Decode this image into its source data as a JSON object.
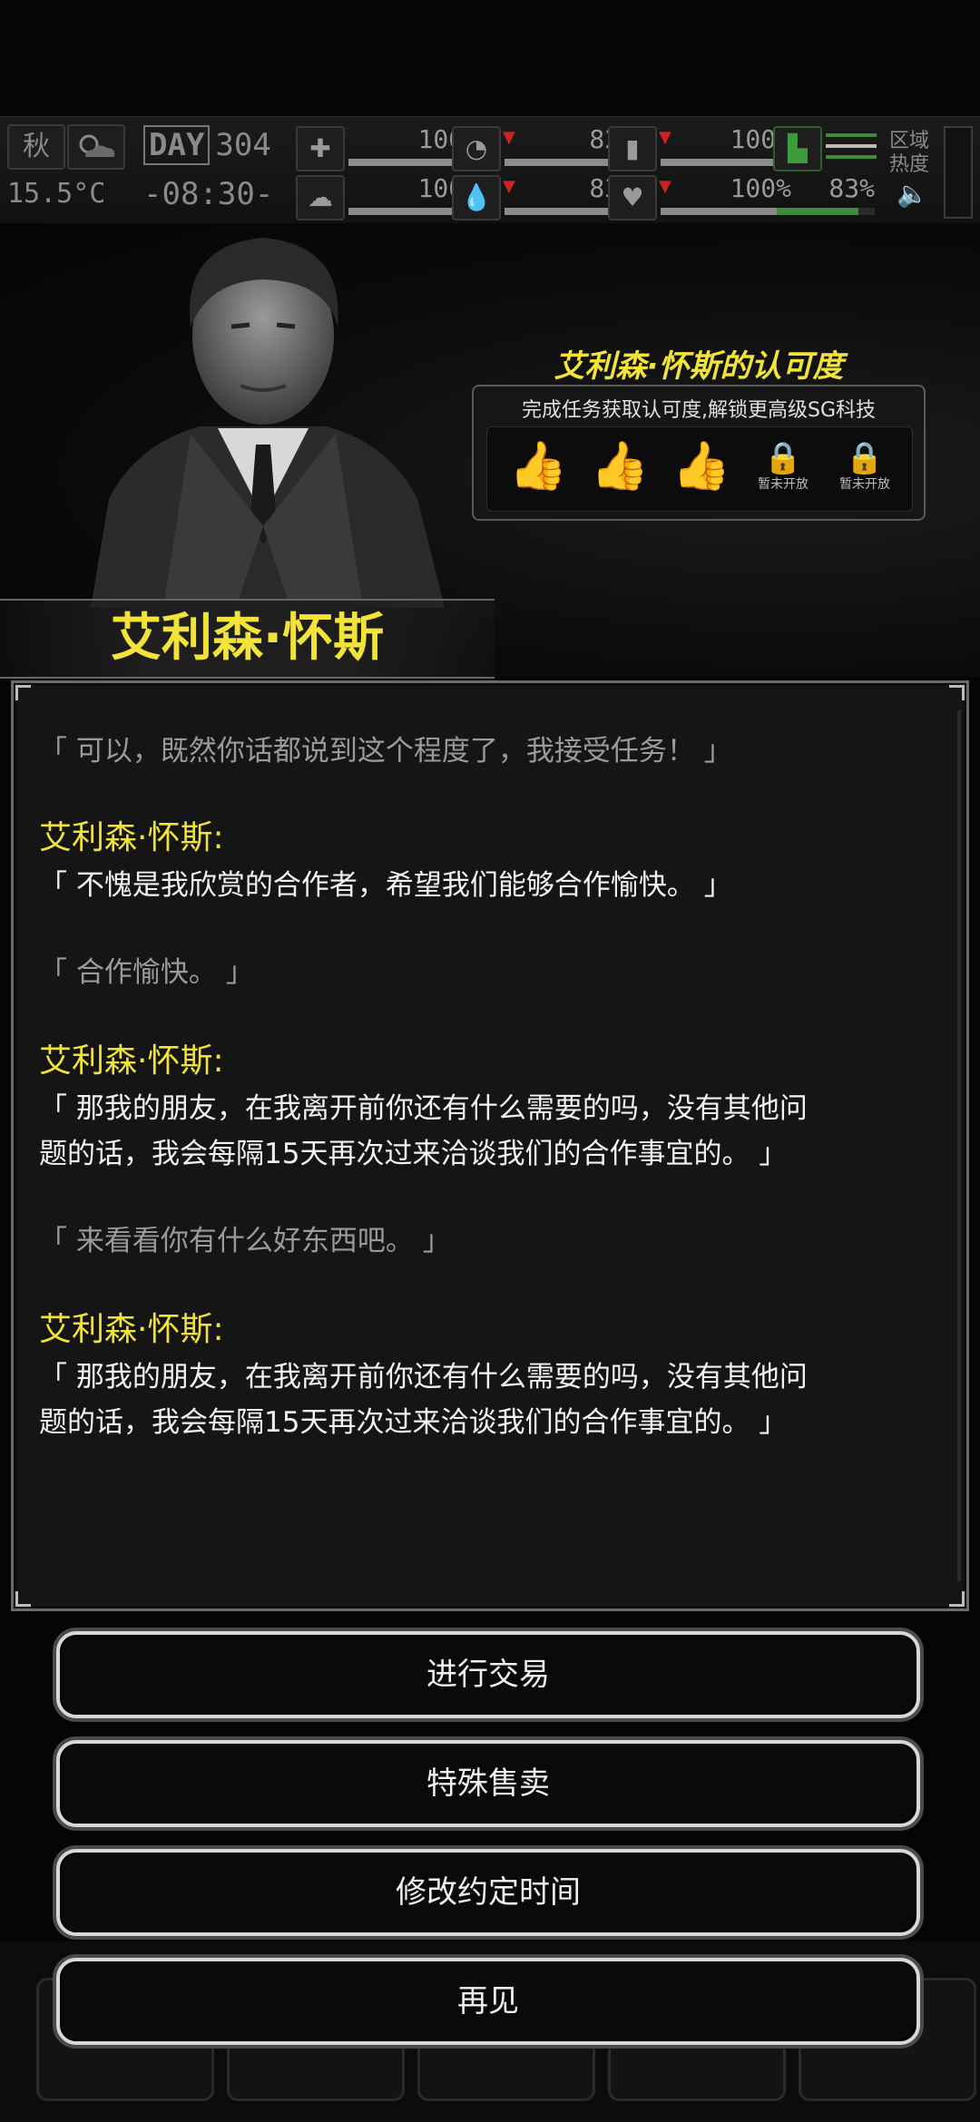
{
  "hud": {
    "season": "秋",
    "temperature": "15.5°C",
    "day_tag": "DAY",
    "day_number": "304",
    "clock": "-08:30-",
    "stats": [
      {
        "name": "health",
        "value": "100%",
        "fill": 1.0
      },
      {
        "name": "hunger",
        "value": "82%",
        "fill": 0.82
      },
      {
        "name": "energy",
        "value": "100%",
        "fill": 1.0
      },
      {
        "name": "mood",
        "value": "100%",
        "fill": 1.0
      },
      {
        "name": "thirst",
        "value": "83%",
        "fill": 0.83
      },
      {
        "name": "heart",
        "value": "100%",
        "fill": 1.0
      }
    ],
    "stamina_value": "83%",
    "zone_label": "区域热度"
  },
  "character": {
    "name": "艾利森·怀斯"
  },
  "approval": {
    "title": "艾利森·怀斯的认可度",
    "description": "完成任务获取认可度,解锁更高级SG科技",
    "slots": [
      {
        "type": "thumb",
        "label": ""
      },
      {
        "type": "thumb",
        "label": ""
      },
      {
        "type": "thumb",
        "label": ""
      },
      {
        "type": "lock",
        "label": "暂未开放"
      },
      {
        "type": "lock",
        "label": "暂未开放"
      }
    ]
  },
  "dialog": {
    "lines": [
      {
        "kind": "player",
        "text": "「 可以，既然你话都说到这个程度了，我接受任务！ 」"
      },
      {
        "kind": "speaker",
        "text": "艾利森·怀斯:"
      },
      {
        "kind": "npc",
        "text": "「 不愧是我欣赏的合作者，希望我们能够合作愉快。 」"
      },
      {
        "kind": "player",
        "text": "「 合作愉快。 」"
      },
      {
        "kind": "speaker",
        "text": "艾利森·怀斯:"
      },
      {
        "kind": "npc",
        "text": "「 那我的朋友，在我离开前你还有什么需要的吗，没有其他问\n题的话，我会每隔15天再次过来洽谈我们的合作事宜的。 」"
      },
      {
        "kind": "player",
        "text": "「 来看看你有什么好东西吧。 」"
      },
      {
        "kind": "speaker",
        "text": "艾利森·怀斯:"
      },
      {
        "kind": "npc",
        "text": "「 那我的朋友，在我离开前你还有什么需要的吗，没有其他问\n题的话，我会每隔15天再次过来洽谈我们的合作事宜的。 」"
      }
    ]
  },
  "buttons": {
    "trade": "进行交易",
    "special_sale": "特殊售卖",
    "change_time": "修改约定时间",
    "goodbye": "再见"
  },
  "colors": {
    "accent_yellow": "#f2e33a",
    "player_text": "#9a9a9a",
    "npc_text": "#f2f2f2"
  }
}
